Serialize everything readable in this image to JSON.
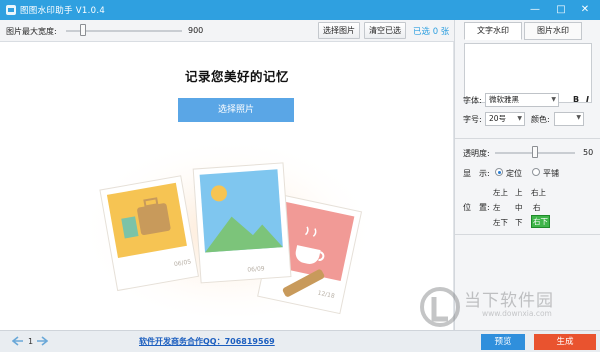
{
  "window": {
    "title": "图图水印助手 V1.0.4",
    "min_glyph": "—",
    "max_glyph": "□",
    "close_glyph": "✕"
  },
  "toolbar": {
    "width_label": "图片最大宽度:",
    "width_value": "900",
    "width_level": 0.15,
    "select_images_label": "选择图片",
    "clear_selected_label": "清空已选",
    "selected_count": "已选 0 张"
  },
  "tabs": [
    {
      "label": "文字水印",
      "active": true
    },
    {
      "label": "图片水印",
      "active": false
    }
  ],
  "font_panel": {
    "font_label": "字体:",
    "font_value": "微软雅黑",
    "bold_label": "B",
    "italic_label": "I",
    "size_label": "字号:",
    "size_value": "20号",
    "color_label": "颜色:"
  },
  "opacity_panel": {
    "label": "透明度:",
    "value": "50",
    "level": 0.5
  },
  "display_panel": {
    "label": "显　示:",
    "option_fixed": "定位",
    "option_tile": "平铺",
    "selected": "定位"
  },
  "position_panel": {
    "label": "位　置:",
    "top_left": "左上",
    "top": "上",
    "top_right": "右上",
    "left": "左",
    "center": "中",
    "right": "右",
    "bottom_left": "左下",
    "bottom": "下",
    "bottom_right": "右下",
    "active": "右下"
  },
  "canvas": {
    "slogan": "记录您美好的记忆",
    "choose_button": "选择照片",
    "photo_captions": [
      "06/05",
      "06/09",
      "12/18"
    ]
  },
  "bottom_bar": {
    "page_number": "1",
    "contact_text": "软件开发商务合作QQ：706819569",
    "preview_label": "预览",
    "generate_label": "生成"
  },
  "watermark": {
    "text": "当下软件园",
    "url": "www.downxia.com"
  },
  "colors": {
    "accent": "#2fa0e0",
    "button_blue": "#5aa6e6",
    "generate_red": "#e9532f",
    "position_active": "#3fb54a"
  }
}
